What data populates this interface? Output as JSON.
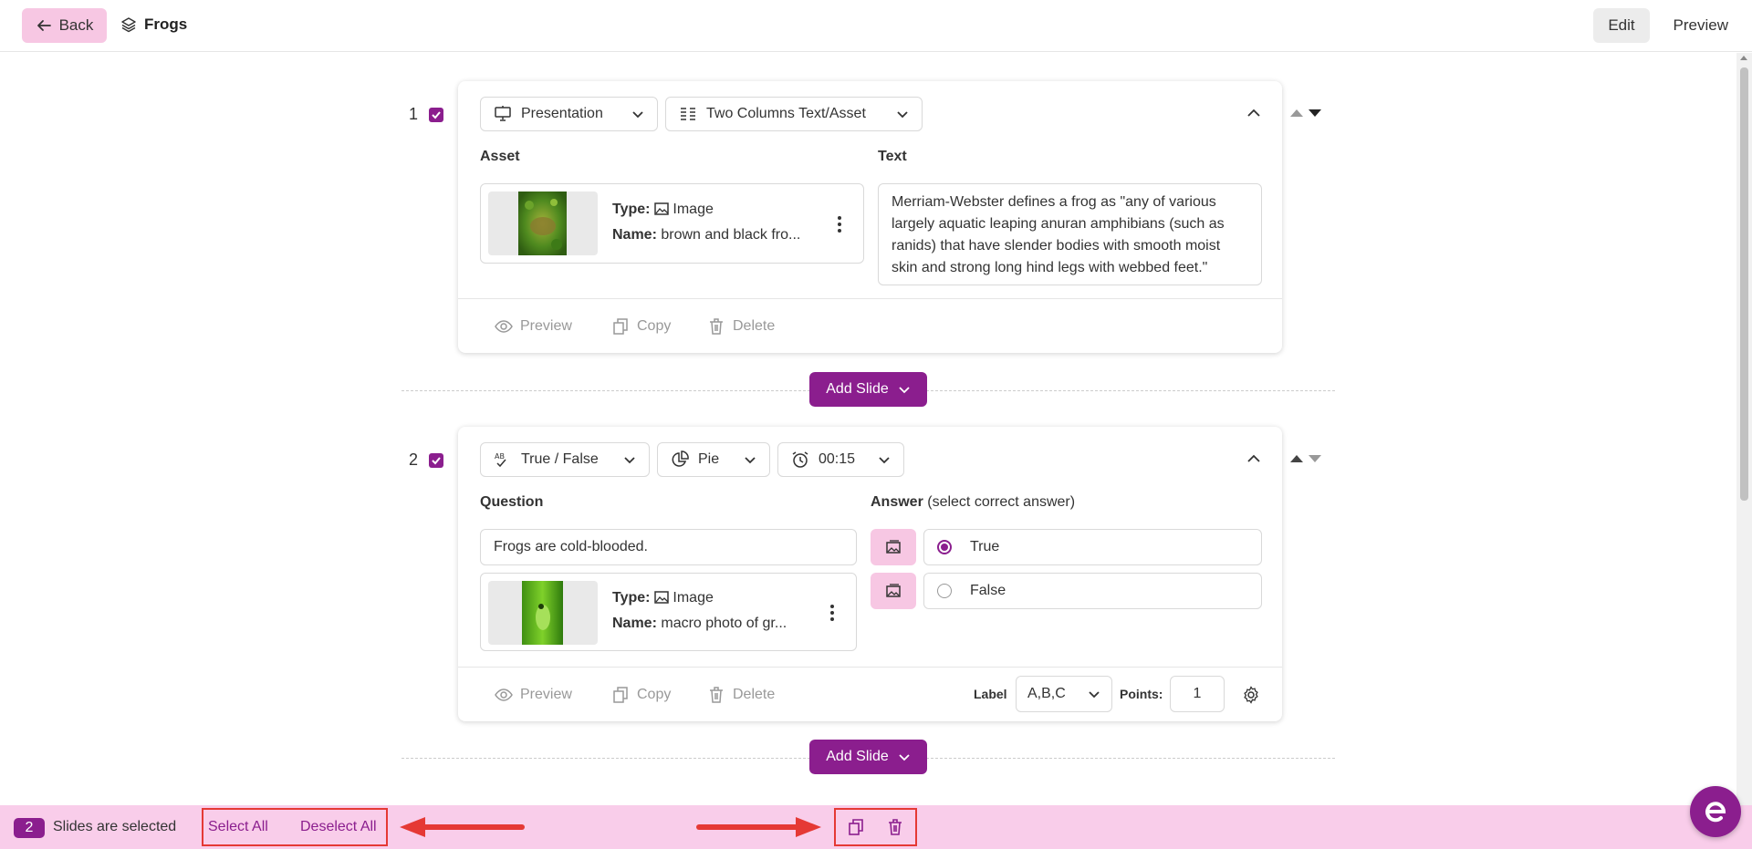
{
  "topbar": {
    "back_label": "Back",
    "deck_title": "Frogs",
    "edit_label": "Edit",
    "preview_label": "Preview"
  },
  "slide1": {
    "number": "1",
    "type_label": "Presentation",
    "layout_label": "Two Columns Text/Asset",
    "asset_heading": "Asset",
    "text_heading": "Text",
    "asset_type_key": "Type:",
    "asset_type_val": "Image",
    "asset_name_key": "Name:",
    "asset_name_val": "brown and black fro...",
    "text_body": "Merriam-Webster defines a frog as \"any of various largely aquatic leaping anuran amphibians (such as ranids) that have slender bodies with smooth moist skin and strong long hind legs with webbed feet.\"",
    "preview_label": "Preview",
    "copy_label": "Copy",
    "delete_label": "Delete"
  },
  "add_slide_label": "Add Slide",
  "slide2": {
    "number": "2",
    "type_label": "True / False",
    "chart_label": "Pie",
    "timer_label": "00:15",
    "question_heading": "Question",
    "answer_heading": "Answer",
    "answer_sub": "(select correct answer)",
    "question_text": "Frogs are cold-blooded.",
    "asset_type_key": "Type:",
    "asset_type_val": "Image",
    "asset_name_key": "Name:",
    "asset_name_val": "macro photo of gr...",
    "answers": [
      {
        "label": "True",
        "selected": true
      },
      {
        "label": "False",
        "selected": false
      }
    ],
    "preview_label": "Preview",
    "copy_label": "Copy",
    "delete_label": "Delete",
    "label_key": "Label",
    "label_value": "A,B,C",
    "points_key": "Points:",
    "points_value": "1"
  },
  "bottombar": {
    "count": "2",
    "selected_text": "Slides are selected",
    "select_all": "Select All",
    "deselect_all": "Deselect All"
  },
  "colors": {
    "accent": "#8b1e8e",
    "accent_light": "#f7c7e3",
    "highlight": "#e53935"
  }
}
